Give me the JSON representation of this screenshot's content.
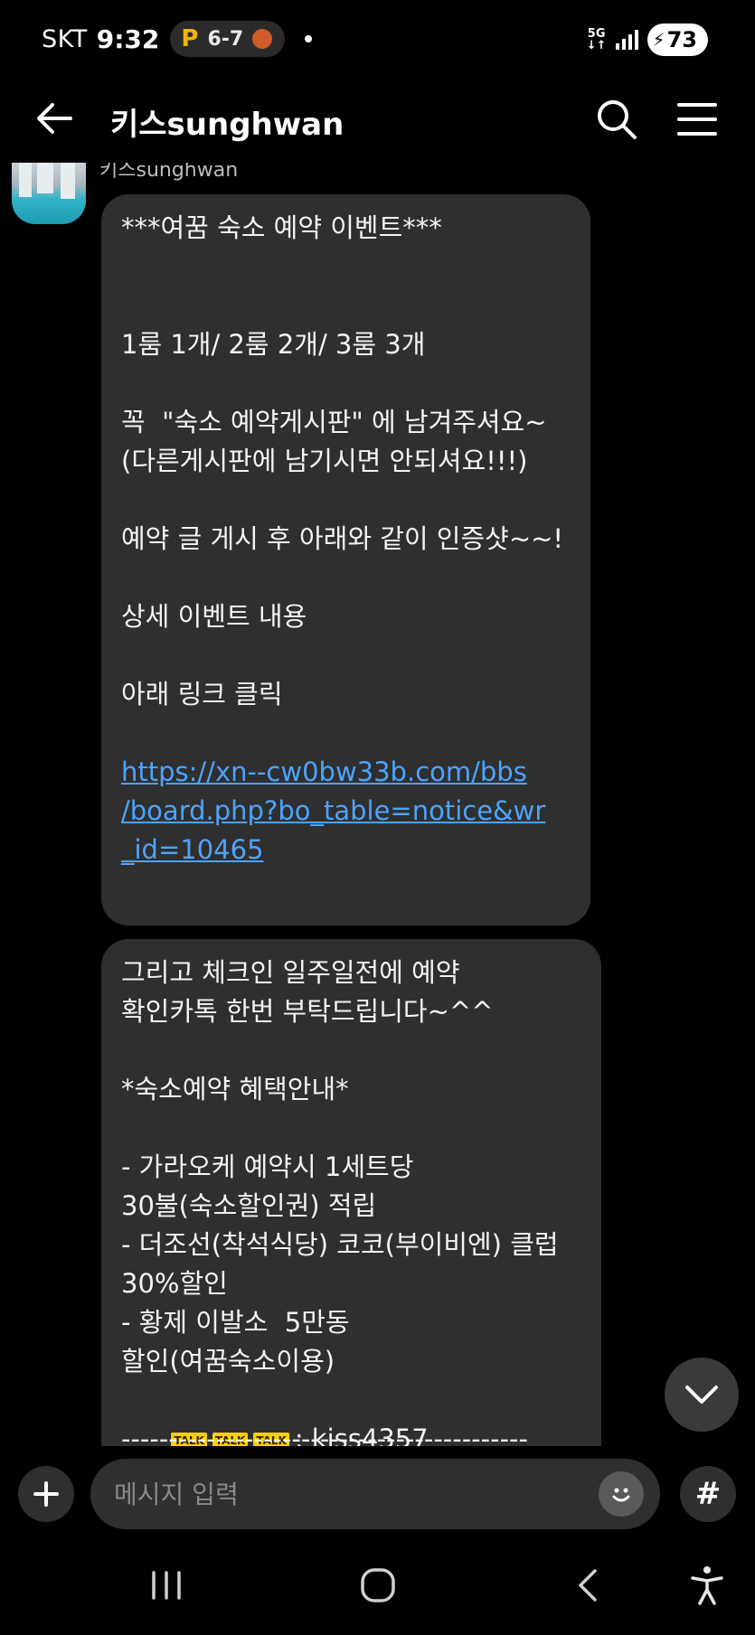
{
  "status_bar": {
    "carrier": "SKT",
    "time": "9:32",
    "score_badge_icon": "P",
    "score": "6-7",
    "network": "5G",
    "battery": "73"
  },
  "header": {
    "title": "키스sunghwan",
    "back_icon": "arrow-left-icon",
    "search_icon": "search-icon",
    "menu_icon": "hamburger-menu-icon"
  },
  "chat": {
    "sender": "키스sunghwan",
    "messages": [
      {
        "lines": [
          "***여꿈 숙소 예약 이벤트***",
          "",
          "",
          "1룸 1개/ 2룸 2개/ 3룸 3개",
          "",
          "꼭  \"숙소 예약게시판\" 에 남겨주셔요~",
          "(다른게시판에 남기시면 안되셔요!!!)",
          "",
          "예약 글 게시 후 아래와 같이 인증샷~~!",
          "",
          "상세 이벤트 내용",
          "",
          "아래 링크 클릭",
          ""
        ],
        "link_lines": [
          "https://xn--cw0bw33b.com/bbs",
          "/board.php?bo_table=notice&wr",
          "_id=10465"
        ]
      },
      {
        "lines": [
          "그리고 체크인 일주일전에 예약",
          "확인카톡 한번 부탁드립니다~^^",
          "",
          "*숙소예약 혜택안내*",
          "",
          "- 가라오케 예약시 1세트당",
          "30불(숙소할인권) 적립",
          "- 더조선(착석식당) 코코(부이비엔) 클럽",
          "30%할인",
          "- 황제 이발소  5만동",
          "할인(여꿈숙소이용)"
        ],
        "talk_badges": [
          "TALK",
          "TALK",
          "TALK"
        ],
        "contact": ": kiss4357",
        "divider": "-------------------------------------------"
      }
    ]
  },
  "input_bar": {
    "placeholder": "메시지 입력",
    "hash_label": "#"
  },
  "colors": {
    "background": "#000000",
    "bubble": "#2f2f2f",
    "link": "#4ea3ff",
    "talk_badge": "#f7d000"
  }
}
